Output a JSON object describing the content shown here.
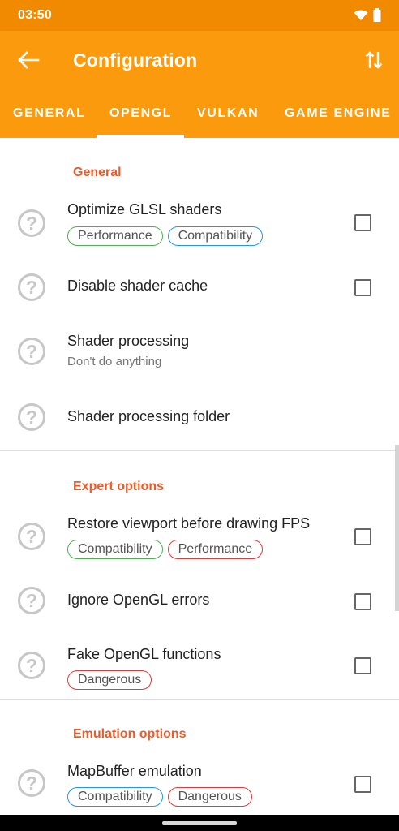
{
  "status_bar": {
    "time": "03:50",
    "icons": [
      "wifi-icon",
      "battery-icon"
    ]
  },
  "app_bar": {
    "title": "Configuration",
    "back_icon": "arrow-back-icon",
    "sort_icon": "swap-vertical-icon"
  },
  "tabs": [
    {
      "label": "GENERAL",
      "selected": false
    },
    {
      "label": "OPENGL",
      "selected": true
    },
    {
      "label": "VULKAN",
      "selected": false
    },
    {
      "label": "GAME ENGINE",
      "selected": false
    }
  ],
  "sections": [
    {
      "title": "General",
      "rows": [
        {
          "title": "Optimize GLSL shaders",
          "tags": [
            {
              "label": "Performance",
              "color": "green"
            },
            {
              "label": "Compatibility",
              "color": "blue"
            }
          ],
          "checked": false
        },
        {
          "title": "Disable shader cache",
          "checked": false
        },
        {
          "title": "Shader processing",
          "subtitle": "Don't do anything"
        },
        {
          "title": "Shader processing folder"
        }
      ]
    },
    {
      "title": "Expert options",
      "rows": [
        {
          "title": "Restore viewport before drawing FPS",
          "tags": [
            {
              "label": "Compatibility",
              "color": "green"
            },
            {
              "label": "Performance",
              "color": "red"
            }
          ],
          "checked": false
        },
        {
          "title": "Ignore OpenGL errors",
          "checked": false
        },
        {
          "title": "Fake OpenGL functions",
          "tags": [
            {
              "label": "Dangerous",
              "color": "red"
            }
          ],
          "checked": false
        }
      ]
    },
    {
      "title": "Emulation options",
      "rows": [
        {
          "title": "MapBuffer emulation",
          "tags": [
            {
              "label": "Compatibility",
              "color": "blue"
            },
            {
              "label": "Dangerous",
              "color": "red"
            }
          ],
          "checked": false
        }
      ]
    }
  ],
  "help_glyph": "?",
  "colors": {
    "status_bar": "#f28a00",
    "app_bar": "#fb9a0c",
    "section_title": "#ee5a2a",
    "tag_green": "#4caf50",
    "tag_blue": "#2196f3",
    "tag_red": "#e53935"
  }
}
